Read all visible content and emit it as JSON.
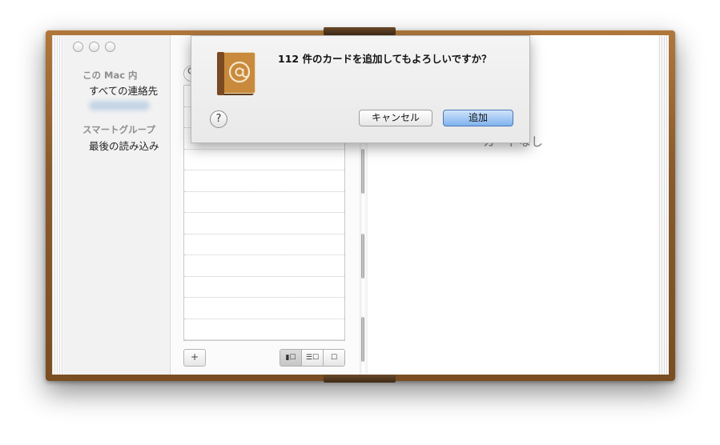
{
  "sidebar": {
    "section_local": "この Mac 内",
    "all_contacts": "すべての連絡先",
    "section_smart": "スマートグループ",
    "last_import": "最後の読み込み"
  },
  "list": {
    "add_button": "+",
    "view_buttons": [
      "▮☐",
      "☰☐",
      "☐"
    ]
  },
  "detail": {
    "empty_text": "カードなし"
  },
  "dialog": {
    "message": "112 件のカードを追加してもよろしいですか？",
    "help": "?",
    "cancel": "キャンセル",
    "add": "追加"
  },
  "colors": {
    "leather": "#8a5a2b",
    "default_button": "#7fb2ee"
  }
}
